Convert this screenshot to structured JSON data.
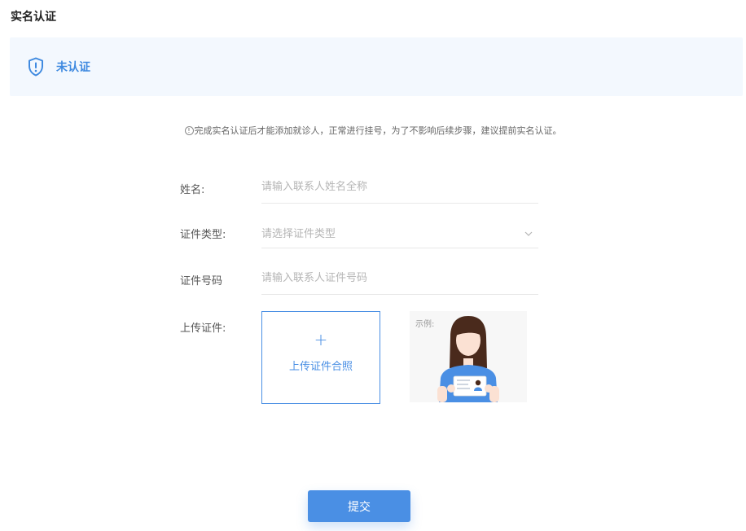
{
  "page": {
    "title": "实名认证"
  },
  "status": {
    "text": "未认证",
    "icon": "shield-alert-icon",
    "color": "#3f8ae0",
    "background": "#f3f8fe"
  },
  "notice": {
    "icon": "info-circle-icon",
    "text": "完成实名认证后才能添加就诊人，正常进行挂号，为了不影响后续步骤，建议提前实名认证。"
  },
  "form": {
    "name": {
      "label": "姓名:",
      "placeholder": "请输入联系人姓名全称",
      "value": ""
    },
    "id_type": {
      "label": "证件类型:",
      "placeholder": "请选择证件类型",
      "icon": "chevron-down-icon"
    },
    "id_number": {
      "label": "证件号码",
      "placeholder": "请输入联系人证件号码",
      "value": ""
    },
    "upload": {
      "label": "上传证件:",
      "plus": "+",
      "button_text": "上传证件合照",
      "example_label": "示例:"
    }
  },
  "submit": {
    "label": "提交"
  },
  "colors": {
    "accent": "#4a8fe4",
    "divider": "#e8e8e8"
  }
}
